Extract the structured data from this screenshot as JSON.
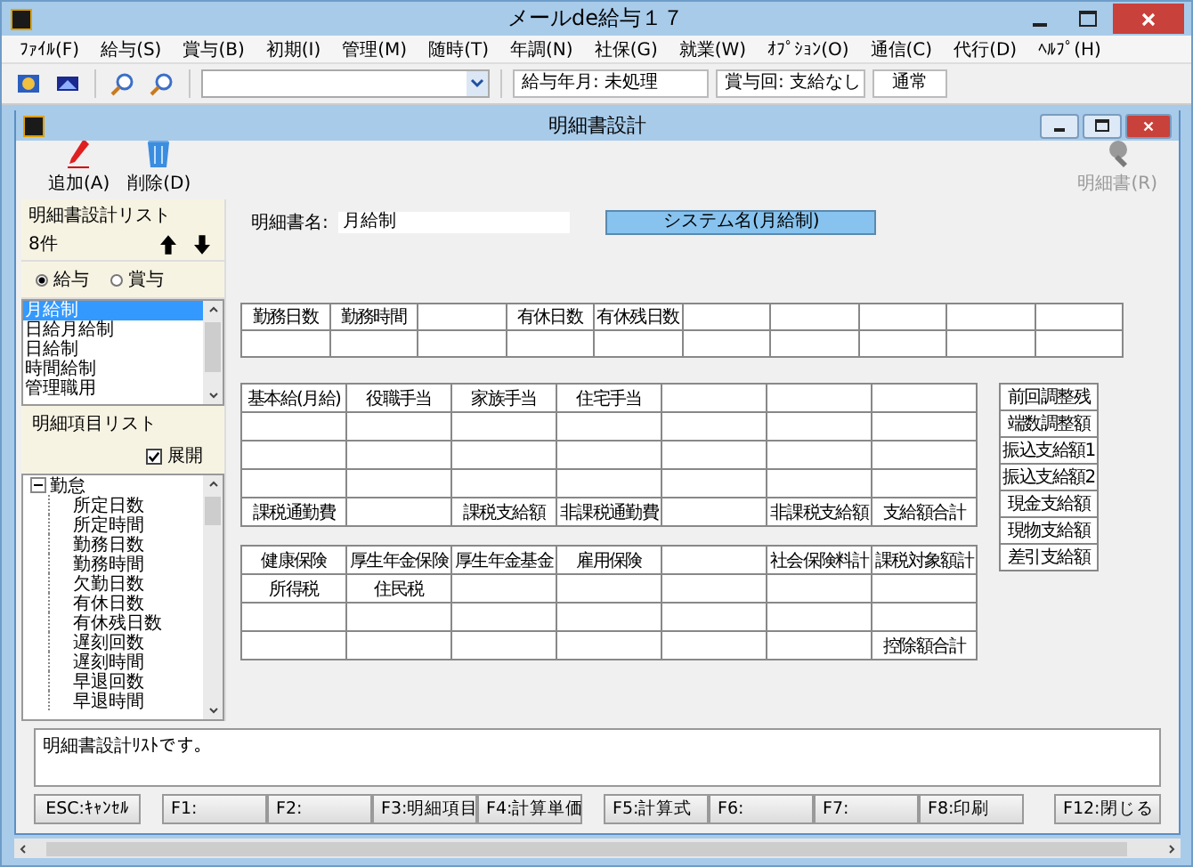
{
  "window": {
    "title": "メールde給与１７"
  },
  "menu": [
    "ﾌｧｲﾙ(F)",
    "給与(S)",
    "賞与(B)",
    "初期(I)",
    "管理(M)",
    "随時(T)",
    "年調(N)",
    "社保(G)",
    "就業(W)",
    "ｵﾌﾟｼｮﾝ(O)",
    "通信(C)",
    "代行(D)",
    "ﾍﾙﾌﾟ(H)"
  ],
  "toolbar": {
    "status": [
      "給与年月: 未処理",
      "賞与回: 支給なし",
      "通常"
    ]
  },
  "child_window": {
    "title": "明細書設計",
    "actions": [
      {
        "kind": "add",
        "label": "追加(A)",
        "disabled": false
      },
      {
        "kind": "delete",
        "label": "削除(D)",
        "disabled": false
      },
      {
        "kind": "statement",
        "label": "明細書(R)",
        "disabled": true
      }
    ],
    "design_list": {
      "title": "明細書設計リスト",
      "count": "8件",
      "radios": [
        {
          "label": "給与",
          "selected": true
        },
        {
          "label": "賞与",
          "selected": false
        }
      ],
      "items": [
        {
          "label": "月給制",
          "selected": true
        },
        {
          "label": "日給月給制",
          "selected": false
        },
        {
          "label": "日給制",
          "selected": false
        },
        {
          "label": "時間給制",
          "selected": false
        },
        {
          "label": "管理職用",
          "selected": false
        }
      ]
    },
    "item_list": {
      "title": "明細項目リスト",
      "expand": {
        "label": "展開",
        "checked": true
      },
      "tree": [
        {
          "label": "勤怠",
          "expanded": true,
          "children": [
            {
              "label": "所定日数"
            },
            {
              "label": "所定時間"
            },
            {
              "label": "勤務日数"
            },
            {
              "label": "勤務時間"
            },
            {
              "label": "欠勤日数"
            },
            {
              "label": "有休日数"
            },
            {
              "label": "有休残日数"
            },
            {
              "label": "遅刻回数"
            },
            {
              "label": "遅刻時間"
            },
            {
              "label": "早退回数"
            },
            {
              "label": "早退時間"
            }
          ]
        }
      ]
    },
    "name_label": "明細書名:",
    "name_value": "月給制",
    "system_name": "システム名(月給制)",
    "attendance_grid": [
      [
        {
          "kind": "item",
          "text": "勤務日数"
        },
        {
          "kind": "item",
          "text": "勤務時間"
        },
        {
          "kind": "blank"
        },
        {
          "kind": "item",
          "text": "有休日数"
        },
        {
          "kind": "item",
          "text": "有休残日数"
        },
        {
          "kind": "blank"
        },
        {
          "kind": "blank"
        },
        {
          "kind": "blank"
        },
        {
          "kind": "blank"
        },
        {
          "kind": "blank"
        }
      ],
      [
        {
          "kind": "blank"
        },
        {
          "kind": "blank"
        },
        {
          "kind": "blank"
        },
        {
          "kind": "blank"
        },
        {
          "kind": "blank"
        },
        {
          "kind": "blank"
        },
        {
          "kind": "blank"
        },
        {
          "kind": "blank"
        },
        {
          "kind": "blank"
        },
        {
          "kind": "blank"
        }
      ]
    ],
    "payment_grid": [
      [
        {
          "kind": "item",
          "text": "基本給(月給)"
        },
        {
          "kind": "item",
          "text": "役職手当"
        },
        {
          "kind": "item",
          "text": "家族手当"
        },
        {
          "kind": "item",
          "text": "住宅手当"
        },
        {
          "kind": "blank"
        },
        {
          "kind": "blank"
        },
        {
          "kind": "blank"
        }
      ],
      [
        {
          "kind": "blank"
        },
        {
          "kind": "blank"
        },
        {
          "kind": "blank"
        },
        {
          "kind": "blank"
        },
        {
          "kind": "blank"
        },
        {
          "kind": "blank"
        },
        {
          "kind": "blank"
        }
      ],
      [
        {
          "kind": "blank"
        },
        {
          "kind": "blank"
        },
        {
          "kind": "blank"
        },
        {
          "kind": "blank"
        },
        {
          "kind": "blank"
        },
        {
          "kind": "blank"
        },
        {
          "kind": "blank"
        }
      ],
      [
        {
          "kind": "blank"
        },
        {
          "kind": "blank"
        },
        {
          "kind": "blank"
        },
        {
          "kind": "blank"
        },
        {
          "kind": "blank"
        },
        {
          "kind": "blank"
        },
        {
          "kind": "blank"
        }
      ],
      [
        {
          "kind": "item",
          "text": "課税通勤費"
        },
        {
          "kind": "blank"
        },
        {
          "kind": "item",
          "text": "課税支給額"
        },
        {
          "kind": "item",
          "text": "非課税通勤費"
        },
        {
          "kind": "blank"
        },
        {
          "kind": "item",
          "text": "非課税支給額"
        },
        {
          "kind": "item",
          "text": "支給額合計"
        }
      ]
    ],
    "deduction_grid": [
      [
        {
          "kind": "item",
          "text": "健康保険"
        },
        {
          "kind": "item",
          "text": "厚生年金保険"
        },
        {
          "kind": "item",
          "text": "厚生年金基金"
        },
        {
          "kind": "item",
          "text": "雇用保険"
        },
        {
          "kind": "blank"
        },
        {
          "kind": "item",
          "text": "社会保険料計"
        },
        {
          "kind": "item",
          "text": "課税対象額計"
        }
      ],
      [
        {
          "kind": "item",
          "text": "所得税"
        },
        {
          "kind": "item",
          "text": "住民税"
        },
        {
          "kind": "blank"
        },
        {
          "kind": "blank"
        },
        {
          "kind": "blank"
        },
        {
          "kind": "blank"
        },
        {
          "kind": "blank"
        }
      ],
      [
        {
          "kind": "blank"
        },
        {
          "kind": "blank"
        },
        {
          "kind": "blank"
        },
        {
          "kind": "blank"
        },
        {
          "kind": "blank"
        },
        {
          "kind": "blank"
        },
        {
          "kind": "blank"
        }
      ],
      [
        {
          "kind": "blank"
        },
        {
          "kind": "blank"
        },
        {
          "kind": "blank"
        },
        {
          "kind": "blank"
        },
        {
          "kind": "blank"
        },
        {
          "kind": "blank"
        },
        {
          "kind": "item",
          "text": "控除額合計"
        }
      ]
    ],
    "totals": [
      "前回調整残",
      "端数調整額",
      "振込支給額1",
      "振込支給額2",
      "現金支給額",
      "現物支給額",
      "差引支給額"
    ],
    "message": "明細書設計ﾘｽﾄです。",
    "function_keys": [
      [
        "ESC:ｷｬﾝｾﾙ"
      ],
      [
        "F1:",
        "F2:",
        "F3:明細項目",
        "F4:計算単価"
      ],
      [
        "F5:計算式",
        "F6:",
        "F7:",
        "F8:印刷"
      ],
      [
        "F12:閉じる"
      ]
    ]
  }
}
